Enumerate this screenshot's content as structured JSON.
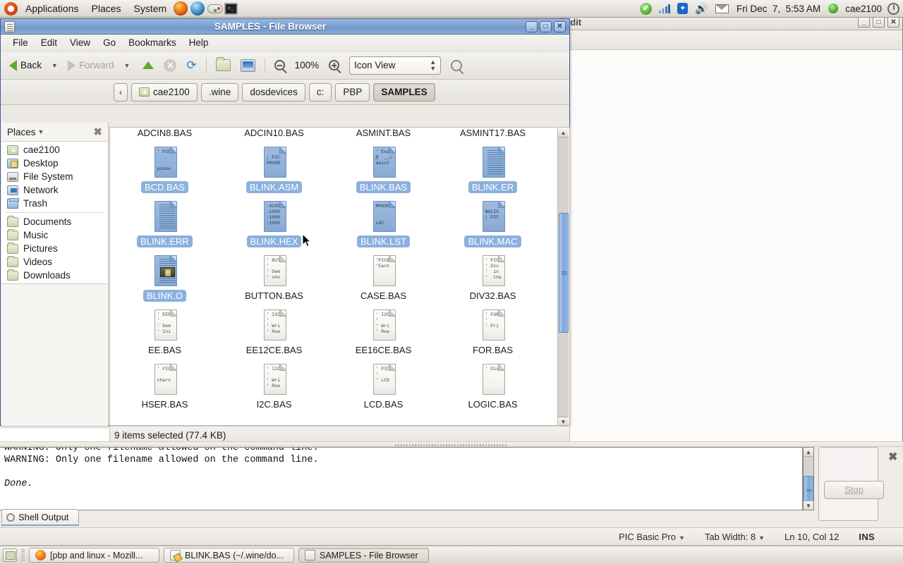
{
  "top_panel": {
    "menus": [
      "Applications",
      "Places",
      "System"
    ],
    "launchers": [
      "firefox-icon",
      "thunderbird-icon",
      "gamepad-icon",
      "terminal-icon"
    ],
    "clock": "Fri Dec  7,  5:53 AM",
    "username": "cae2100",
    "indicators": [
      "checkmark-icon",
      "signal-bars-icon",
      "bluetooth-icon",
      "volume-icon",
      "mail-icon"
    ]
  },
  "background_window": {
    "title": "edit",
    "buttons": [
      "minimize",
      "maximize",
      "close"
    ]
  },
  "file_browser": {
    "title": "SAMPLES - File Browser",
    "window_buttons": [
      "_",
      "□",
      "✕"
    ],
    "menu": [
      "File",
      "Edit",
      "View",
      "Go",
      "Bookmarks",
      "Help"
    ],
    "toolbar": {
      "back": "Back",
      "forward": "Forward",
      "zoom_level": "100%",
      "view_mode": "Icon View"
    },
    "path_buttons": [
      {
        "label": "‹",
        "type": "prev"
      },
      {
        "label": "cae2100",
        "type": "home"
      },
      {
        "label": ".wine",
        "type": "normal"
      },
      {
        "label": "dosdevices",
        "type": "normal"
      },
      {
        "label": "c:",
        "type": "normal"
      },
      {
        "label": "PBP",
        "type": "normal"
      },
      {
        "label": "SAMPLES",
        "type": "current"
      }
    ],
    "sidebar": {
      "header": "Places",
      "group1": [
        {
          "label": "cae2100",
          "icon": "home-icon"
        },
        {
          "label": "Desktop",
          "icon": "desktop-icon"
        },
        {
          "label": "File System",
          "icon": "filesystem-icon"
        },
        {
          "label": "Network",
          "icon": "network-icon"
        },
        {
          "label": "Trash",
          "icon": "trash-icon"
        }
      ],
      "group2": [
        {
          "label": "Documents",
          "icon": "folder-icon"
        },
        {
          "label": "Music",
          "icon": "folder-icon"
        },
        {
          "label": "Pictures",
          "icon": "folder-icon"
        },
        {
          "label": "Videos",
          "icon": "folder-icon"
        },
        {
          "label": "Downloads",
          "icon": "folder-icon"
        }
      ]
    },
    "files": [
      {
        "name": "ADCIN8.BAS",
        "selected": false,
        "preview": "",
        "style": "clipped"
      },
      {
        "name": "ADCIN10.BAS",
        "selected": false,
        "preview": "",
        "style": "clipped"
      },
      {
        "name": "ASMINT.BAS",
        "selected": false,
        "preview": "",
        "style": "clipped"
      },
      {
        "name": "ASMINT17.BAS",
        "selected": false,
        "preview": "",
        "style": "clipped"
      },
      {
        "name": "BCD.BAS",
        "selected": true,
        "preview": "' PIC\n\n\npinou",
        "style": "text"
      },
      {
        "name": "BLINK.ASM",
        "selected": true,
        "preview": "\n; PIC\nPROGR",
        "style": "text"
      },
      {
        "name": "BLINK.BAS",
        "selected": true,
        "preview": "' Exa\n@  __c\nmainl",
        "style": "text"
      },
      {
        "name": "BLINK.ER",
        "selected": true,
        "preview": "",
        "style": "lines"
      },
      {
        "name": "BLINK.ERR",
        "selected": true,
        "preview": "",
        "style": "lines"
      },
      {
        "name": "BLINK.HEX",
        "selected": true,
        "preview": ":0200\n:1000\n:1000\n:1000",
        "style": "text"
      },
      {
        "name": "BLINK.LST",
        "selected": true,
        "preview": "MPASM\n\n\nLOC",
        "style": "text"
      },
      {
        "name": "BLINK.MAC",
        "selected": true,
        "preview": "\nNOLIS\n; PIC",
        "style": "text"
      },
      {
        "name": "BLINK.O",
        "selected": true,
        "preview": "",
        "style": "image"
      },
      {
        "name": "BUTTON.BAS",
        "selected": false,
        "preview": "' BUT\n'\n' Dem\n' sho",
        "style": "text"
      },
      {
        "name": "CASE.BAS",
        "selected": false,
        "preview": "'PICB\n'Each",
        "style": "text"
      },
      {
        "name": "DIV32.BAS",
        "selected": false,
        "preview": "' PIC\n' Div\n'  in\n'  the",
        "style": "text"
      },
      {
        "name": "EE.BAS",
        "selected": false,
        "preview": "' EEP\n'\n' Dem\n' Ini",
        "style": "text"
      },
      {
        "name": "EE12CE.BAS",
        "selected": false,
        "preview": "' I2C\n'\n' Wri\n' Rea",
        "style": "text"
      },
      {
        "name": "EE16CE.BAS",
        "selected": false,
        "preview": "' I2C\n'\n' Wri\n' Rea",
        "style": "text"
      },
      {
        "name": "FOR.BAS",
        "selected": false,
        "preview": "' FOR\n'\n' Pri",
        "style": "text"
      },
      {
        "name": "HSER.BAS",
        "selected": false,
        "preview": "' PIC\n\ncharv",
        "style": "text"
      },
      {
        "name": "I2C.BAS",
        "selected": false,
        "preview": "' I2C\n'\n' Wri\n' Rea",
        "style": "text"
      },
      {
        "name": "LCD.BAS",
        "selected": false,
        "preview": "' PIC\n'\n' LCD",
        "style": "text"
      },
      {
        "name": "LOGIC.BAS",
        "selected": false,
        "preview": "' Dis",
        "style": "text"
      }
    ],
    "status": "9 items selected (77.4 KB)"
  },
  "shell_panel": {
    "lines": [
      "WARNING: Only one filename allowed on the command line.",
      "WARNING: Only one filename allowed on the command line.",
      "",
      "Done."
    ],
    "stop_button": "Stop",
    "tab_label": "Shell Output"
  },
  "editor_status": {
    "language": "PIC Basic Pro",
    "tab_width": "Tab Width:  8",
    "position": "Ln 10, Col 12",
    "insert_mode": "INS"
  },
  "taskbar": [
    {
      "label": "[pbp and linux - Mozill...",
      "icon": "firefox-icon",
      "active": false
    },
    {
      "label": "BLINK.BAS (~/.wine/do...",
      "icon": "document-icon",
      "active": false
    },
    {
      "label": "SAMPLES - File Browser",
      "icon": "filebrowser-icon",
      "active": true
    }
  ],
  "colors": {
    "selection_blue": "#8ab0de",
    "titlebar_blue": "#7ea2d2",
    "panel_grey": "#e6e2dc"
  }
}
